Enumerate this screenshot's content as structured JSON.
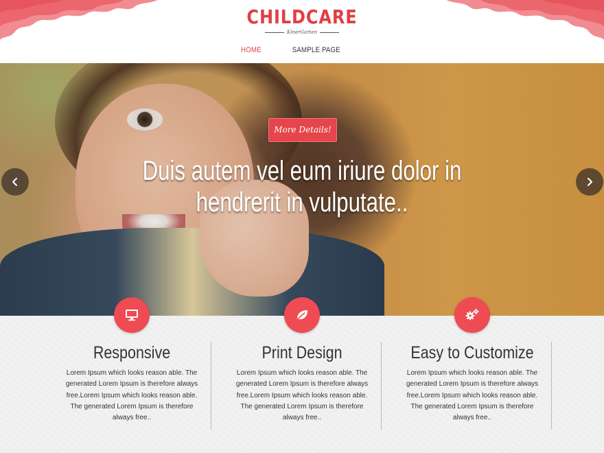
{
  "brand": {
    "title": "CHILDCARE",
    "subtitle": "KinerGarten",
    "accent_color": "#e23f45"
  },
  "nav": {
    "items": [
      {
        "label": "HOME",
        "active": true
      },
      {
        "label": "SAMPLE PAGE",
        "active": false
      }
    ]
  },
  "slider": {
    "button_label": "More Details!",
    "caption": "Duis autem vel eum iriure dolor in hendrerit in vulputate..",
    "prev_icon": "chevron-left-icon",
    "next_icon": "chevron-right-icon"
  },
  "features": [
    {
      "icon": "monitor-icon",
      "title": "Responsive",
      "text": "Lorem Ipsum which looks reason able. The generated Lorem Ipsum is therefore always free.Lorem Ipsum which looks reason able. The generated Lorem Ipsum is therefore always free.."
    },
    {
      "icon": "leaf-icon",
      "title": "Print Design",
      "text": "Lorem Ipsum which looks reason able. The generated Lorem Ipsum is therefore always free.Lorem Ipsum which looks reason able. The generated Lorem Ipsum is therefore always free.."
    },
    {
      "icon": "gears-icon",
      "title": "Easy to Customize",
      "text": "Lorem Ipsum which looks reason able. The generated Lorem Ipsum is therefore always free.Lorem Ipsum which looks reason able. The generated Lorem Ipsum is therefore always free.."
    }
  ]
}
